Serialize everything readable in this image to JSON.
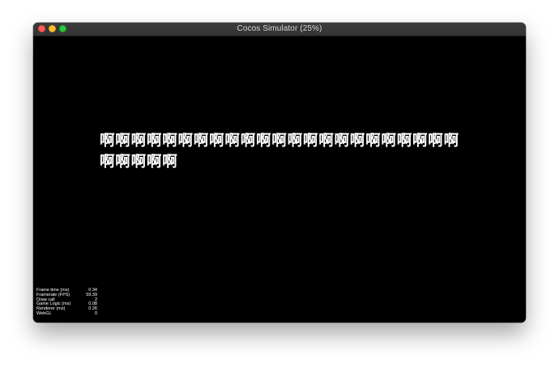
{
  "window": {
    "title": "Cocos Simulator (25%)"
  },
  "scene": {
    "label_text": "啊啊啊啊啊啊啊啊啊啊啊啊啊啊啊啊啊啊啊啊啊啊啊啊啊啊啊啊"
  },
  "stats": [
    {
      "label": "Frame time (ms)",
      "value": "0.34"
    },
    {
      "label": "Framerate (FPS)",
      "value": "59.39"
    },
    {
      "label": "Draw call",
      "value": "2"
    },
    {
      "label": "Game Logic (ms)",
      "value": "0.08"
    },
    {
      "label": "Renderer (ms)",
      "value": "0.26"
    },
    {
      "label": "WebGL",
      "value": "0"
    }
  ],
  "colors": {
    "close": "#ff5f57",
    "minimize": "#febc2e",
    "maximize": "#28c840",
    "canvas": "#000000",
    "text": "#ffffff"
  }
}
